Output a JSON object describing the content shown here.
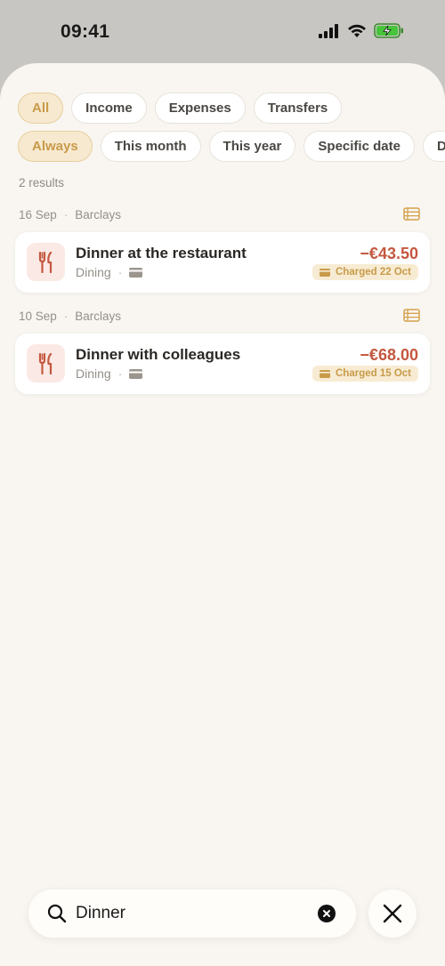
{
  "status_bar": {
    "time": "09:41"
  },
  "filters": {
    "types": [
      {
        "label": "All",
        "active": true
      },
      {
        "label": "Income",
        "active": false
      },
      {
        "label": "Expenses",
        "active": false
      },
      {
        "label": "Transfers",
        "active": false
      }
    ],
    "dates": [
      {
        "label": "Always",
        "active": true
      },
      {
        "label": "This month",
        "active": false
      },
      {
        "label": "This year",
        "active": false
      },
      {
        "label": "Specific date",
        "active": false
      },
      {
        "label": "Date r",
        "active": false
      }
    ]
  },
  "results_count": "2 results",
  "groups": [
    {
      "date": "16 Sep",
      "account": "Barclays",
      "transaction": {
        "title": "Dinner at the restaurant",
        "category": "Dining",
        "amount": "−€43.50",
        "charged": "Charged 22 Oct"
      }
    },
    {
      "date": "10 Sep",
      "account": "Barclays",
      "transaction": {
        "title": "Dinner with colleagues",
        "category": "Dining",
        "amount": "−€68.00",
        "charged": "Charged 15 Oct"
      }
    }
  ],
  "search": {
    "value": "Dinner",
    "placeholder": ""
  },
  "icons": {
    "category": "fork-knife-icon",
    "card": "credit-card-icon",
    "list": "list-view-icon",
    "search": "search-icon",
    "clear": "clear-icon",
    "close": "close-icon"
  },
  "colors": {
    "accent": "#c99a4a",
    "accent_bg": "#f6e9cf",
    "negative_amount": "#c4583f",
    "background": "#f9f6f1"
  }
}
